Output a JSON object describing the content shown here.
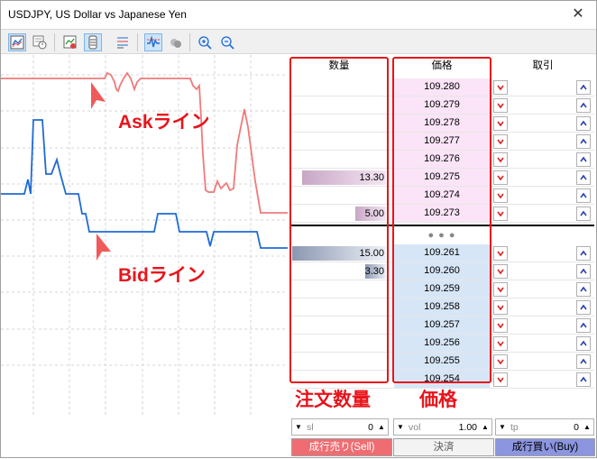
{
  "window": {
    "title": "USDJPY, US Dollar vs Japanese Yen",
    "close_glyph": "✕"
  },
  "toolbar": {
    "buttons": [
      "line-chart-icon",
      "clock-chart-icon",
      "bubble-chart-icon",
      "volume-icon",
      "depth-icon",
      "trade-lines-icon",
      "ask-bid-icon",
      "zoom-in-icon",
      "zoom-out-icon"
    ]
  },
  "chart": {
    "annotations": {
      "ask": "Askライン",
      "bid": "Bidライン"
    },
    "colors": {
      "ask": "#f07a7a",
      "bid": "#1f6ad6",
      "arrow": "#f05a5a",
      "annotation": "#e8141b"
    }
  },
  "dom": {
    "headers": {
      "quantity": "数量",
      "price": "価格",
      "trade": "取引"
    },
    "ask_rows": [
      {
        "price": "109.280",
        "qty": "",
        "bar": 0
      },
      {
        "price": "109.279",
        "qty": "",
        "bar": 0
      },
      {
        "price": "109.278",
        "qty": "",
        "bar": 0
      },
      {
        "price": "109.277",
        "qty": "",
        "bar": 0
      },
      {
        "price": "109.276",
        "qty": "",
        "bar": 0
      },
      {
        "price": "109.275",
        "qty": "13.30",
        "bar": 0.89
      },
      {
        "price": "109.274",
        "qty": "",
        "bar": 0
      },
      {
        "price": "109.273",
        "qty": "5.00",
        "bar": 0.33
      }
    ],
    "spread_dots": "● ● ●",
    "bid_rows": [
      {
        "price": "109.261",
        "qty": "15.00",
        "bar": 1.0
      },
      {
        "price": "109.260",
        "qty": "3.30",
        "bar": 0.22
      },
      {
        "price": "109.259",
        "qty": "",
        "bar": 0
      },
      {
        "price": "109.258",
        "qty": "",
        "bar": 0
      },
      {
        "price": "109.257",
        "qty": "",
        "bar": 0
      },
      {
        "price": "109.256",
        "qty": "",
        "bar": 0
      },
      {
        "price": "109.255",
        "qty": "",
        "bar": 0
      },
      {
        "price": "109.254",
        "qty": "",
        "bar": 0
      }
    ],
    "annotations": {
      "quantity": "注文数量",
      "price": "価格"
    }
  },
  "bottom": {
    "sl": {
      "placeholder": "sl",
      "value": "0"
    },
    "vol": {
      "placeholder": "vol",
      "value": "1.00"
    },
    "tp": {
      "placeholder": "tp",
      "value": "0"
    },
    "sell_label": "成行売り(Sell)",
    "close_label": "決済",
    "buy_label": "成行買い(Buy)"
  }
}
